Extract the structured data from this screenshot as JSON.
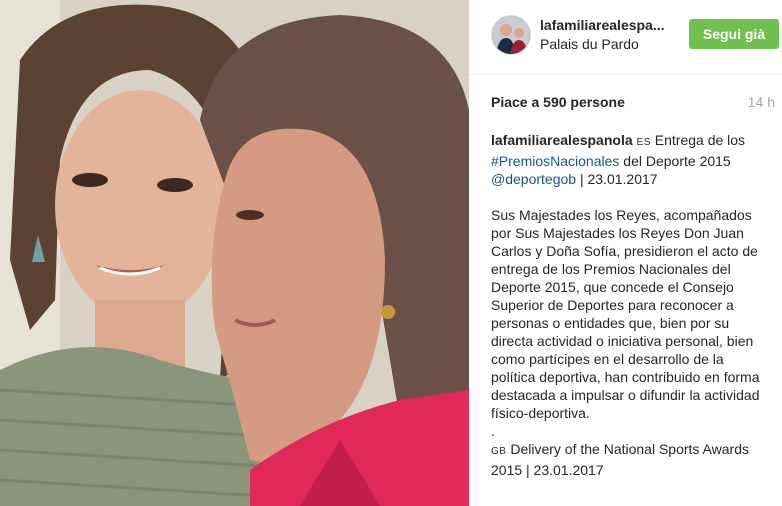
{
  "header": {
    "username": "lafamiliarealespa...",
    "location": "Palais du Pardo",
    "follow_label": "Segui già"
  },
  "stats": {
    "likes": "Piace a 590 persone",
    "time": "14 h"
  },
  "caption": {
    "username": "lafamiliarealespanola",
    "flag_es": "ES",
    "text1": " Entrega de los",
    "hashtag": "#PremiosNacionales",
    "text2": " del Deporte 2015",
    "mention": "@deportegob",
    "text3": " | 23.01.2017",
    "paragraph": "Sus Majestades los Reyes, acompañados por Sus Majestades los Reyes Don Juan Carlos y Doña Sofía, presidieron el acto de entrega de los Premios Nacionales del Deporte 2015, que concede el Consejo Superior de Deportes para reconocer a personas o entidades que, bien por su directa actividad o iniciativa personal, bien como partícipes en el desarrollo de la política deportiva, han contribuido en forma destacada a impulsar o difundir la actividad físico-deportiva.",
    "dot": ".",
    "flag_gb": "GB",
    "english": " Delivery of the National Sports Awards 2015 | 23.01.2017"
  },
  "colors": {
    "follow_green": "#70c050",
    "link_blue": "#125688",
    "time_gray": "#a5a7aa"
  }
}
